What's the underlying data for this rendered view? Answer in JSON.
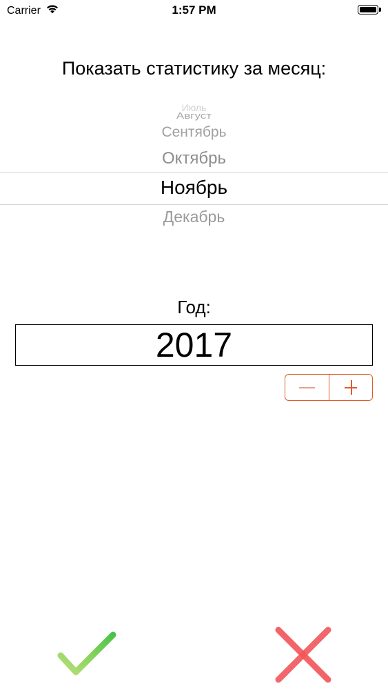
{
  "status_bar": {
    "carrier": "Carrier",
    "time": "1:57 PM"
  },
  "month_title": "Показать статистику за месяц:",
  "month_picker": {
    "items_above": [
      "Июль",
      "Август",
      "Сентябрь",
      "Октябрь"
    ],
    "selected": "Ноябрь",
    "items_below": [
      "Декабрь"
    ]
  },
  "year": {
    "label": "Год:",
    "value": "2017"
  },
  "colors": {
    "accent": "#e05a2a",
    "confirm": "#5ccc4a",
    "cancel": "#f2565a"
  },
  "icons": {
    "confirm": "checkmark-icon",
    "cancel": "close-icon",
    "stepper_minus": "minus-icon",
    "stepper_plus": "plus-icon"
  }
}
